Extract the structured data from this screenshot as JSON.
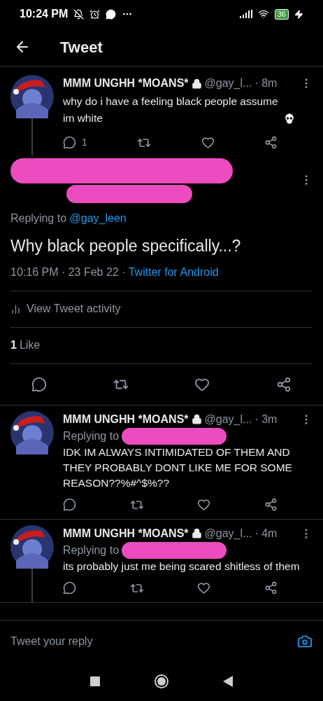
{
  "status_bar": {
    "time": "10:24 PM",
    "battery": "36"
  },
  "header": {
    "title": "Tweet"
  },
  "parent_tweet": {
    "name": "MMM UNGHH *MOANS*",
    "locked": true,
    "handle": "@gay_l...",
    "time": "· 8m",
    "text": "why do i have a feeling black people assume im white",
    "reply_count": "1"
  },
  "main_tweet": {
    "replying_prefix": "Replying to",
    "replying_handle": "@gay_leen",
    "text": "Why black people specifically...?",
    "timestamp": "10:16 PM · 23 Feb 22 ·",
    "source": "Twitter for Android",
    "activity": "View Tweet activity",
    "likes_count": "1",
    "likes_label": "Like"
  },
  "replies": [
    {
      "name": "MMM UNGHH *MOANS*",
      "locked": true,
      "handle": "@gay_l...",
      "time": "· 3m",
      "replying_prefix": "Replying to",
      "text": "IDK IM ALWAYS INTIMIDATED OF THEM AND THEY PROBABLY DONT LIKE ME FOR SOME REASON??%#^$%??",
      "thread_continues": false
    },
    {
      "name": "MMM UNGHH *MOANS*",
      "locked": true,
      "handle": "@gay_l...",
      "time": "· 4m",
      "replying_prefix": "Replying to",
      "text": "its probably just me being scared shitless of them",
      "thread_continues": true
    }
  ],
  "reply_bar": {
    "placeholder": "Tweet your reply"
  }
}
